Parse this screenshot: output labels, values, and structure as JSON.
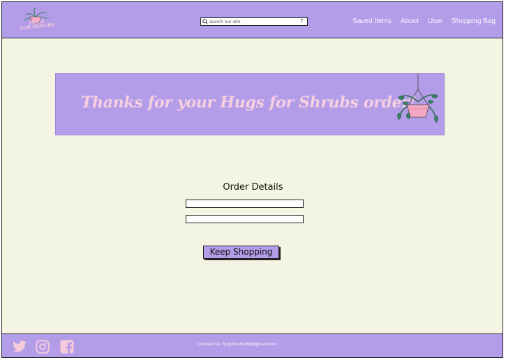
{
  "header": {
    "logo_text_line1": "HUGS",
    "logo_text_line2": "FOR SHRUBS",
    "search_placeholder": "search our site",
    "search_submit_glyph": "⇡",
    "nav": [
      "Saved Items",
      "About",
      "User",
      "Shopping Bag"
    ]
  },
  "banner": {
    "text": "Thanks for your Hugs for Shrubs order!"
  },
  "order": {
    "title": "Order Details",
    "field1_value": "",
    "field2_value": "",
    "button_label": "Keep Shopping"
  },
  "footer": {
    "icons": [
      "twitter-icon",
      "instagram-icon",
      "facebook-icon"
    ],
    "contact": "Contact Us: hugsforshrubs@gmail.com"
  },
  "colors": {
    "accent": "#b39ce8",
    "background": "#f3f4e2",
    "banner_text": "#f6cfe0",
    "icon": "#f4c9dc"
  }
}
